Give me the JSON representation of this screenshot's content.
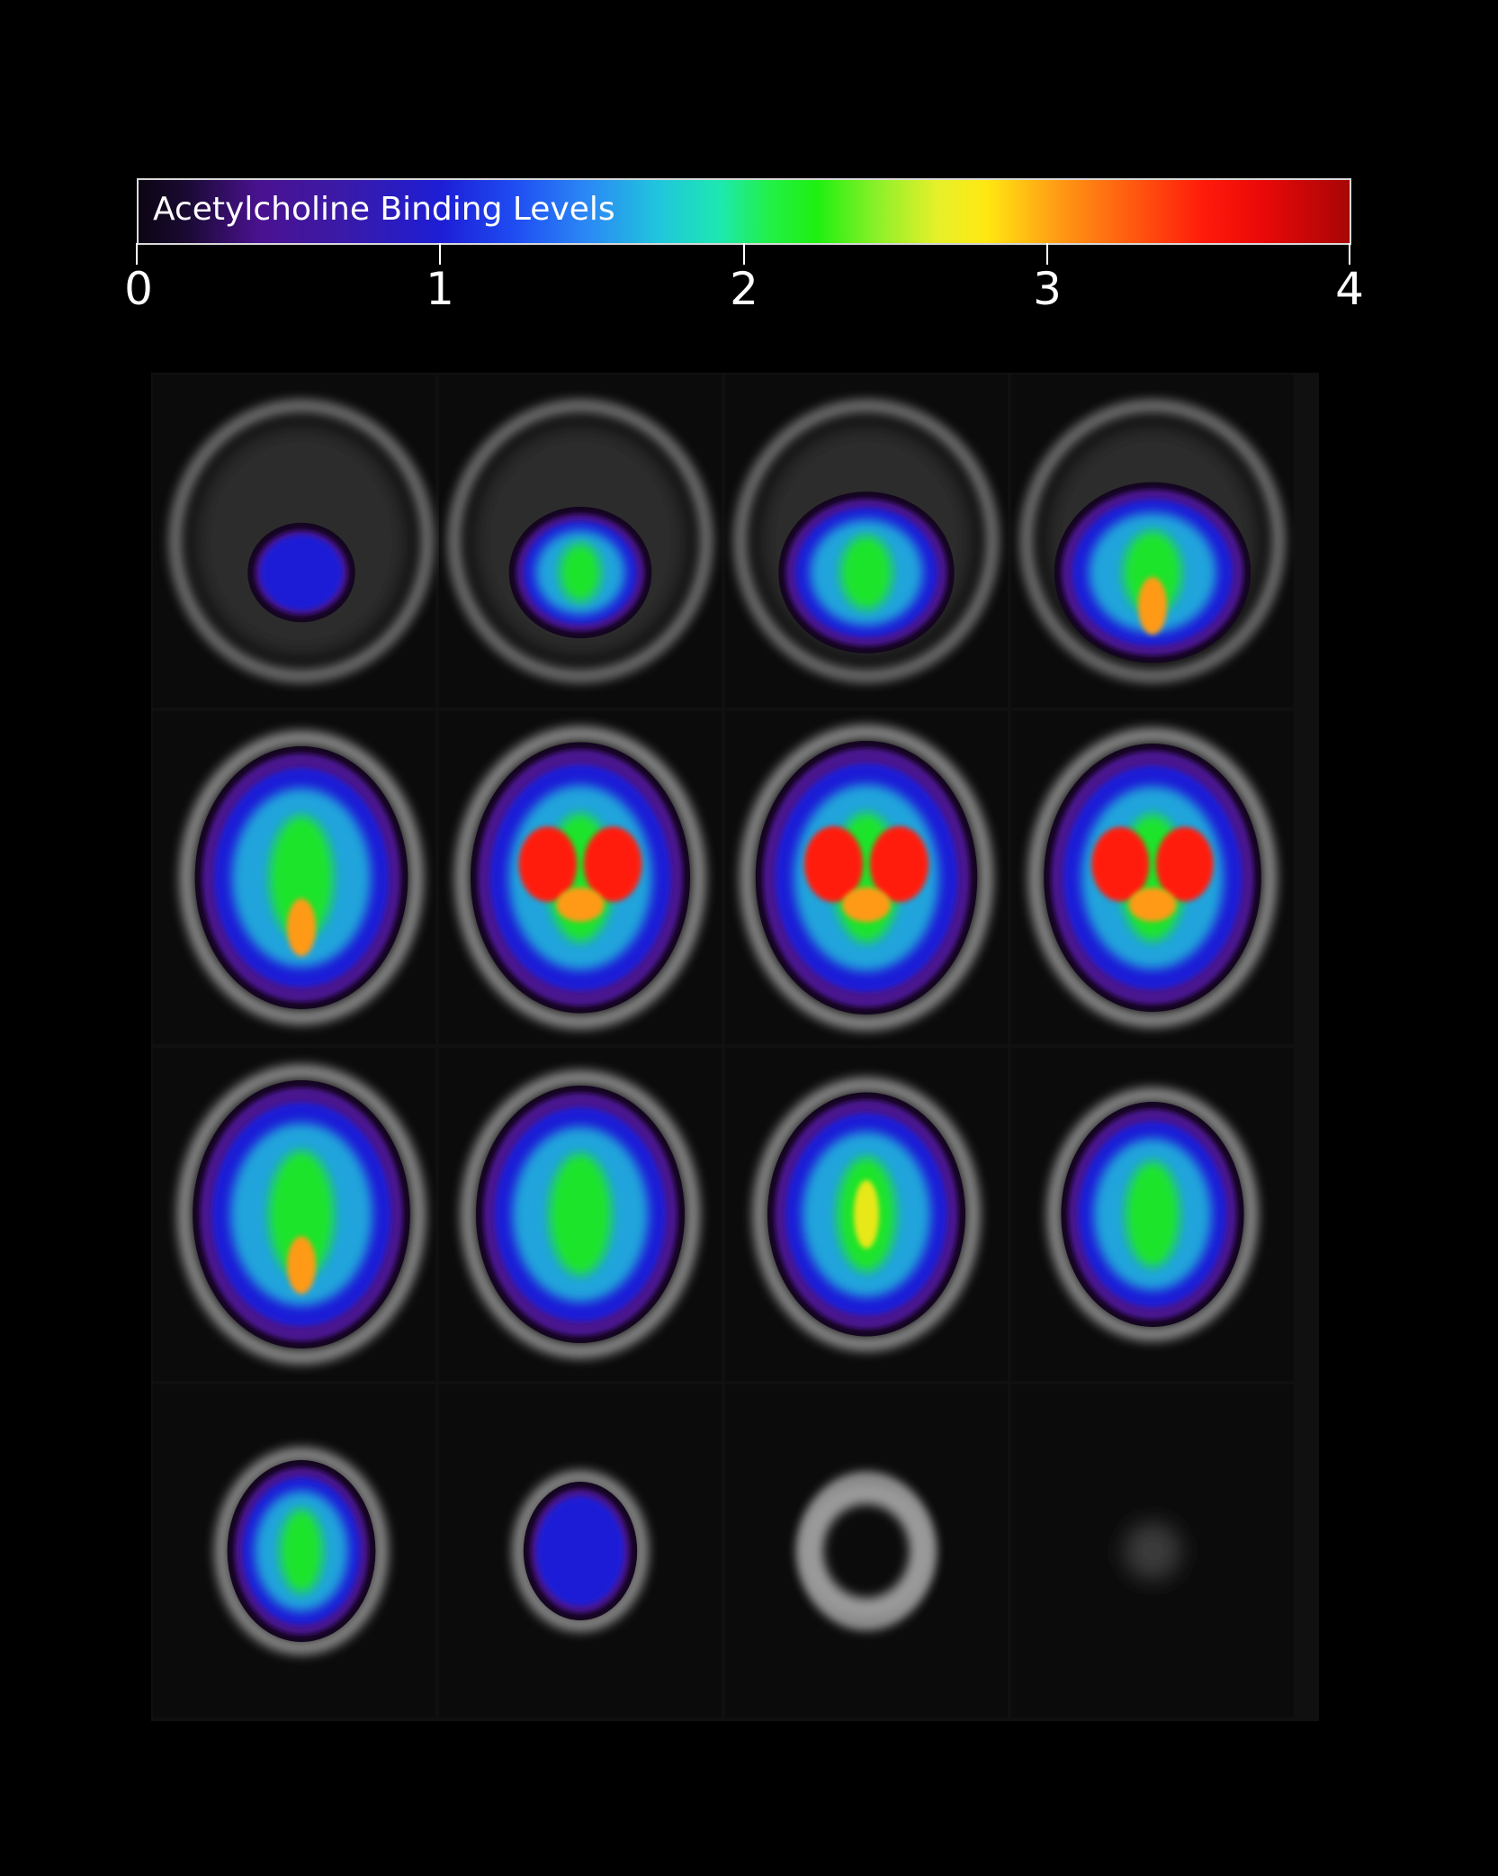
{
  "colorbar": {
    "title": "Acetylcholine Binding Levels",
    "ticks": [
      "0",
      "1",
      "2",
      "3",
      "4"
    ]
  },
  "colormap": {
    "low": "#1a0a33",
    "purple": "#4a1290",
    "blue": "#1d1ed6",
    "cyan": "#20c6dd",
    "green": "#1ef010",
    "yellow": "#ffe812",
    "orange": "#ff9a14",
    "red": "#ff1a0a",
    "high": "#a80606"
  },
  "slices": [
    {
      "row": 1,
      "col": 1,
      "peak_level": 1.0
    },
    {
      "row": 1,
      "col": 2,
      "peak_level": 1.9
    },
    {
      "row": 1,
      "col": 3,
      "peak_level": 2.2
    },
    {
      "row": 1,
      "col": 4,
      "peak_level": 3.2
    },
    {
      "row": 2,
      "col": 1,
      "peak_level": 3.3
    },
    {
      "row": 2,
      "col": 2,
      "peak_level": 3.6
    },
    {
      "row": 2,
      "col": 3,
      "peak_level": 3.6
    },
    {
      "row": 2,
      "col": 4,
      "peak_level": 3.5
    },
    {
      "row": 3,
      "col": 1,
      "peak_level": 3.1
    },
    {
      "row": 3,
      "col": 2,
      "peak_level": 2.2
    },
    {
      "row": 3,
      "col": 3,
      "peak_level": 2.4
    },
    {
      "row": 3,
      "col": 4,
      "peak_level": 2.1
    },
    {
      "row": 4,
      "col": 1,
      "peak_level": 2.0
    },
    {
      "row": 4,
      "col": 2,
      "peak_level": 1.1
    },
    {
      "row": 4,
      "col": 3,
      "peak_level": 0.0
    },
    {
      "row": 4,
      "col": 4,
      "peak_level": 0.0
    }
  ]
}
